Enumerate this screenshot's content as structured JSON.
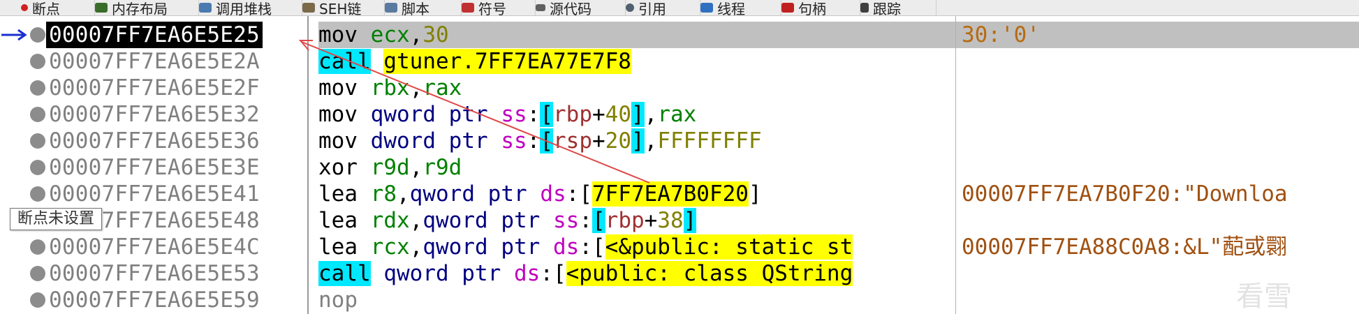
{
  "tabs": [
    {
      "label": "断点",
      "icon": "breakpoint-icon",
      "color": "#d02020"
    },
    {
      "label": "内存布局",
      "icon": "memory-map-icon",
      "color": "#3a6d2a"
    },
    {
      "label": "调用堆栈",
      "icon": "call-stack-icon",
      "color": "#4a7ab0"
    },
    {
      "label": "SEH链",
      "icon": "seh-chain-icon",
      "color": "#7a6a4a"
    },
    {
      "label": "脚本",
      "icon": "script-icon",
      "color": "#5a7aa0"
    },
    {
      "label": "符号",
      "icon": "symbols-icon",
      "color": "#c03030"
    },
    {
      "label": "源代码",
      "icon": "source-icon",
      "color": "#606060"
    },
    {
      "label": "引用",
      "icon": "references-icon",
      "color": "#506070"
    },
    {
      "label": "线程",
      "icon": "threads-icon",
      "color": "#3070c0"
    },
    {
      "label": "句柄",
      "icon": "handles-icon",
      "color": "#c02020"
    },
    {
      "label": "跟踪",
      "icon": "trace-icon",
      "color": "#404040"
    }
  ],
  "rows": [
    {
      "addr": "00007FF7EA6E5E25",
      "comment": "30:'0'"
    },
    {
      "addr": "00007FF7EA6E5E2A",
      "comment": ""
    },
    {
      "addr": "00007FF7EA6E5E2F",
      "comment": ""
    },
    {
      "addr": "00007FF7EA6E5E32",
      "comment": ""
    },
    {
      "addr": "00007FF7EA6E5E36",
      "comment": ""
    },
    {
      "addr": "00007FF7EA6E5E3E",
      "comment": ""
    },
    {
      "addr": "00007FF7EA6E5E41",
      "comment": "00007FF7EA7B0F20:\"Downloa"
    },
    {
      "addr": "00007FF7EA6E5E48",
      "comment": ""
    },
    {
      "addr": "00007FF7EA6E5E4C",
      "comment": "00007FF7EA88C0A8:&L\"蓜或翾"
    },
    {
      "addr": "00007FF7EA6E5E53",
      "comment": ""
    },
    {
      "addr": "00007FF7EA6E5E59",
      "comment": ""
    }
  ],
  "asm": {
    "r0": {
      "mn": "mov",
      "a": "ecx",
      "b": "30"
    },
    "r1": {
      "mn": "call",
      "target": "gtuner.7FF7EA77E7F8"
    },
    "r2": {
      "mn": "mov",
      "a": "rbx",
      "b": "rax"
    },
    "r3": {
      "mn": "mov",
      "size": "qword ptr",
      "seg": "ss",
      "base": "rbp",
      "off": "40",
      "src": "rax"
    },
    "r4": {
      "mn": "mov",
      "size": "dword ptr",
      "seg": "ss",
      "base": "rsp",
      "off": "20",
      "src": "FFFFFFFF"
    },
    "r5": {
      "mn": "xor",
      "a": "r9d",
      "b": "r9d"
    },
    "r6": {
      "mn": "lea",
      "dst": "r8",
      "size": "qword ptr",
      "seg": "ds",
      "addr": "7FF7EA7B0F20"
    },
    "r7": {
      "mn": "lea",
      "dst": "rdx",
      "size": "qword ptr",
      "seg": "ss",
      "base": "rbp",
      "off": "38"
    },
    "r8": {
      "mn": "lea",
      "dst": "rcx",
      "size": "qword ptr",
      "seg": "ds",
      "sym": "<&public: static st"
    },
    "r9": {
      "mn": "call",
      "size": "qword ptr",
      "seg": "ds",
      "sym": "<public: class QString"
    },
    "r10": {
      "mn": "nop"
    }
  },
  "tooltip": "断点未设置",
  "watermark": "看雪",
  "colors": {
    "selection": "#c0c0c0",
    "highlight_cyan": "#00e8ff",
    "highlight_yellow": "#ffff00",
    "comment": "#a05010",
    "register": "#008000"
  }
}
